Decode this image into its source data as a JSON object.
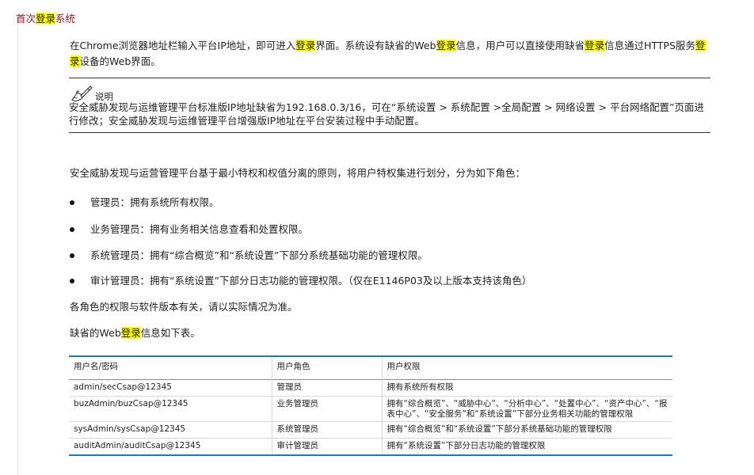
{
  "section_title": {
    "prefix": "首次",
    "highlight": "登录",
    "suffix": "系统"
  },
  "intro_paragraph": [
    {
      "text": "在Chrome浏览器地址栏输入平台IP地址，即可进入",
      "hl": false
    },
    {
      "text": "登录",
      "hl": true
    },
    {
      "text": "界面。系统设有缺省的Web",
      "hl": false
    },
    {
      "text": "登录",
      "hl": true
    },
    {
      "text": "信息，用户可以直接使用缺省",
      "hl": false
    },
    {
      "text": "登录",
      "hl": true
    },
    {
      "text": "信息通过HTTPS服务",
      "hl": false
    },
    {
      "text": "登录",
      "hl": true
    },
    {
      "text": "设备的Web界面。",
      "hl": false
    }
  ],
  "note": {
    "icon": "hand-writing-note-icon",
    "label": "说明",
    "text": "安全威胁发现与运维管理平台标准版IP地址缺省为192.168.0.3/16，可在“系统设置 > 系统配置 >全局配置 > 网络设置 > 平台网络配置”页面进行修改；安全威胁发现与运维管理平台增强版IP地址在平台安装过程中手动配置。"
  },
  "roles_intro": "安全威胁发现与运营管理平台基于最小特权和权值分离的原则，将用户特权集进行划分，分为如下角色：",
  "roles": [
    "管理员：拥有系统所有权限。",
    "业务管理员：拥有业务相关信息查看和处置权限。",
    "系统管理员：拥有“综合概览”和“系统设置”下部分系统基础功能的管理权限。",
    "审计管理员：拥有“系统设置”下部分日志功能的管理权限。（仅在E1146P03及以上版本支持该角色）"
  ],
  "version_note": "各角色的权限与软件版本有关，请以实际情况为准。",
  "table_intro": [
    {
      "text": "缺省的Web",
      "hl": false
    },
    {
      "text": "登录",
      "hl": true
    },
    {
      "text": "信息如下表。",
      "hl": false
    }
  ],
  "table": {
    "headers": [
      "用户名/密码",
      "用户角色",
      "用户权限"
    ],
    "rows": [
      [
        "admin/secCsap@12345",
        "管理员",
        "拥有系统所有权限"
      ],
      [
        "buzAdmin/buzCsap@12345",
        "业务管理员",
        "拥有“综合概览”、“威胁中心”、“分析中心”、“处置中心”、“资产中心”、“报表中心”、“安全服务”和“系统设置”下部分业务相关功能的管理权限"
      ],
      [
        "sysAdmin/sysCsap@12345",
        "系统管理员",
        "拥有“综合概览”和“系统设置”下部分系统基础功能的管理权限"
      ],
      [
        "auditAdmin/auditCsap@12345",
        "审计管理员",
        "拥有“系统设置”下部分日志功能的管理权限"
      ]
    ]
  },
  "colors": {
    "title": "#8b1a1a",
    "highlight": "#ffff00",
    "table_rule": "#1f7aa8"
  }
}
